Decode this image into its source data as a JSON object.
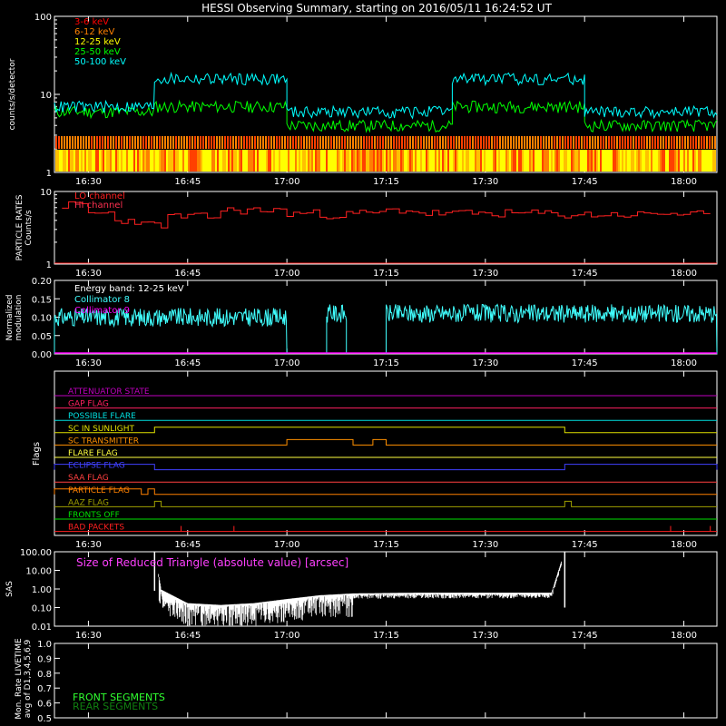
{
  "title": "HESSI Observing Summary, starting on 2016/05/11 16:24:52 UT",
  "time_axis": {
    "start": "16:24:52",
    "end": "18:05:00",
    "ticks": [
      "16:30",
      "16:45",
      "17:00",
      "17:15",
      "17:30",
      "17:45",
      "18:00"
    ]
  },
  "chart_data": [
    {
      "type": "line",
      "panel": "count-rates",
      "ylabel": "counts/s/detector",
      "yscale": "log",
      "ylim": [
        1,
        100
      ],
      "yticks": [
        "100",
        "10",
        "1"
      ],
      "legend_position": "top-left",
      "series": [
        {
          "name": "3-6 keV",
          "color": "#ff0000"
        },
        {
          "name": "6-12 keV",
          "color": "#ff8000"
        },
        {
          "name": "12-25 keV",
          "color": "#ffff00"
        },
        {
          "name": "25-50 keV",
          "color": "#00ff00"
        },
        {
          "name": "50-100 keV",
          "color": "#00ffff"
        }
      ],
      "segments": [
        {
          "from": "16:24:52",
          "to": "16:40",
          "values": {
            "3-6 keV": 1.5,
            "6-12 keV": 3.0,
            "12-25 keV": 2.0,
            "25-50 keV": 6.0,
            "50-100 keV": 7.0
          }
        },
        {
          "from": "16:40",
          "to": "17:00",
          "values": {
            "3-6 keV": 1.5,
            "6-12 keV": 3.0,
            "12-25 keV": 2.0,
            "25-50 keV": 7.0,
            "50-100 keV": 16.0
          }
        },
        {
          "from": "17:00",
          "to": "17:25",
          "values": {
            "3-6 keV": 1.5,
            "6-12 keV": 3.0,
            "12-25 keV": 2.0,
            "25-50 keV": 4.0,
            "50-100 keV": 6.0
          }
        },
        {
          "from": "17:25",
          "to": "17:45",
          "values": {
            "3-6 keV": 1.5,
            "6-12 keV": 3.0,
            "12-25 keV": 2.0,
            "25-50 keV": 7.0,
            "50-100 keV": 16.0
          }
        },
        {
          "from": "17:45",
          "to": "18:05",
          "values": {
            "3-6 keV": 1.5,
            "6-12 keV": 3.0,
            "12-25 keV": 2.0,
            "25-50 keV": 4.0,
            "50-100 keV": 6.0
          }
        }
      ]
    },
    {
      "type": "line",
      "panel": "particle-rates",
      "ylabel": "PARTICLE RATES Counts/s",
      "yscale": "log",
      "ylim": [
        1,
        10
      ],
      "yticks": [
        "10",
        "1"
      ],
      "series": [
        {
          "name": "LO channel",
          "color": "#ff2020"
        },
        {
          "name": "HI channel",
          "color": "#ff3050"
        }
      ],
      "x": [
        "16:26",
        "16:30",
        "16:34",
        "16:38",
        "16:42",
        "16:46",
        "16:50",
        "16:55",
        "17:00",
        "17:05",
        "17:10",
        "17:15",
        "17:20",
        "17:25",
        "17:30",
        "17:35",
        "17:40",
        "17:45",
        "17:50",
        "17:55",
        "18:00",
        "18:04"
      ],
      "values": [
        6.5,
        5.0,
        4.0,
        3.5,
        4.5,
        4.5,
        5.5,
        5.5,
        5.0,
        4.8,
        5.0,
        5.5,
        5.0,
        5.0,
        5.0,
        5.0,
        4.8,
        4.8,
        4.8,
        5.0,
        4.8,
        5.0
      ]
    },
    {
      "type": "line",
      "panel": "modulation",
      "ylabel": "Normalized modulation",
      "ylim": [
        0,
        0.2
      ],
      "yticks": [
        "0.20",
        "0.15",
        "0.10",
        "0.05",
        "0.00"
      ],
      "annotation": "Energy band: 12-25 keV",
      "series": [
        {
          "name": "Collimator 8",
          "color": "#40ffff"
        },
        {
          "name": "Collimator 9",
          "color": "#ff00ff"
        }
      ],
      "collimator8_segments": [
        {
          "from": "16:24:52",
          "to": "17:00",
          "value": 0.1
        },
        {
          "from": "17:06",
          "to": "17:09",
          "value": 0.11
        },
        {
          "from": "17:15",
          "to": "18:05",
          "value": 0.11
        }
      ],
      "collimator9_value": 0.0
    },
    {
      "type": "line",
      "panel": "flags",
      "ylabel": "Flags",
      "flags": [
        {
          "name": "ATTENUATOR STATE",
          "color": "#c000c0",
          "on": []
        },
        {
          "name": "GAP FLAG",
          "color": "#ff2060",
          "on": []
        },
        {
          "name": "POSSIBLE FLARE",
          "color": "#00e0e0",
          "on": []
        },
        {
          "name": "SC IN SUNLIGHT",
          "color": "#e0e000",
          "on": [
            [
              "16:40",
              "17:42"
            ]
          ]
        },
        {
          "name": "SC TRANSMITTER",
          "color": "#ff9000",
          "on": [
            [
              "17:00",
              "17:10"
            ],
            [
              "17:13",
              "17:15"
            ]
          ]
        },
        {
          "name": "FLARE FLAG",
          "color": "#ffff40",
          "on": []
        },
        {
          "name": "ECLIPSE FLAG",
          "color": "#4040ff",
          "on": [
            [
              "16:24:52",
              "16:40"
            ],
            [
              "17:42",
              "18:05"
            ]
          ]
        },
        {
          "name": "SAA FLAG",
          "color": "#ff4040",
          "on": []
        },
        {
          "name": "PARTICLE FLAG",
          "color": "#ff8000",
          "on": [
            [
              "16:24:52",
              "16:38"
            ],
            [
              "16:39",
              "16:40"
            ]
          ]
        },
        {
          "name": "AAZ FLAG",
          "color": "#a0a000",
          "on": [
            [
              "16:40",
              "16:41"
            ],
            [
              "17:42",
              "17:43"
            ]
          ]
        },
        {
          "name": "FRONTS OFF",
          "color": "#00e000",
          "on": []
        },
        {
          "name": "BAD PACKETS",
          "color": "#ff2020",
          "on": [
            [
              "16:44",
              "16:44"
            ],
            [
              "16:52",
              "16:52"
            ],
            [
              "17:58",
              "17:58"
            ],
            [
              "18:04",
              "18:04"
            ]
          ]
        }
      ]
    },
    {
      "type": "line",
      "panel": "sas",
      "ylabel": "SAS",
      "yscale": "log",
      "ylim": [
        0.01,
        100
      ],
      "yticks": [
        "100.00",
        "10.00",
        "1.00",
        "0.10",
        "0.01"
      ],
      "annotation": "Size of Reduced Triangle (absolute value) [arcsec]",
      "series": [
        {
          "name": "Size of Reduced Triangle",
          "color": "#ffffff"
        }
      ],
      "x": [
        "16:40",
        "16:41",
        "16:45",
        "16:50",
        "16:55",
        "17:00",
        "17:05",
        "17:10",
        "17:20",
        "17:30",
        "17:40",
        "17:42"
      ],
      "values": [
        100,
        0.8,
        0.15,
        0.12,
        0.15,
        0.25,
        0.4,
        0.5,
        0.55,
        0.55,
        0.55,
        100
      ]
    },
    {
      "type": "line",
      "panel": "livetime",
      "ylabel": "Mon. Rate LIVETIME avg of D1,3,4,5,6,9",
      "ylim": [
        0.5,
        1.0
      ],
      "yticks": [
        "1.0",
        "0.9",
        "0.8",
        "0.7",
        "0.6",
        "0.5"
      ],
      "series": [
        {
          "name": "FRONT SEGMENTS",
          "color": "#30ff30"
        },
        {
          "name": "REAR SEGMENTS",
          "color": "#108010"
        }
      ]
    }
  ]
}
